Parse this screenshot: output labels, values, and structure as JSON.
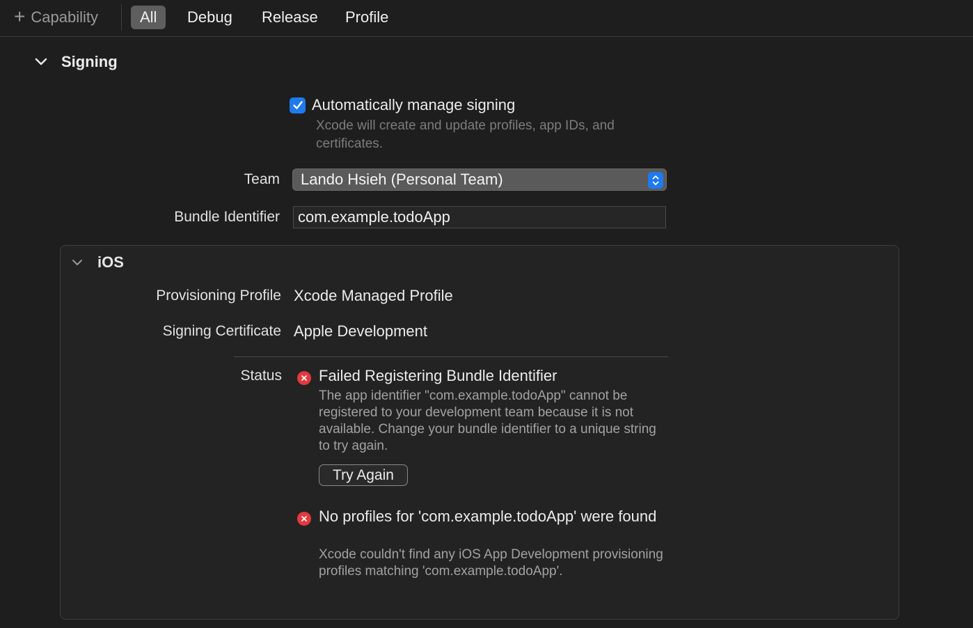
{
  "toolbar": {
    "capability_label": "Capability",
    "tabs": [
      {
        "label": "All",
        "active": true
      },
      {
        "label": "Debug",
        "active": false
      },
      {
        "label": "Release",
        "active": false
      },
      {
        "label": "Profile",
        "active": false
      }
    ]
  },
  "signing": {
    "title": "Signing",
    "auto_manage": {
      "label": "Automatically manage signing",
      "checked": true,
      "description": "Xcode will create and update profiles, app IDs, and certificates."
    },
    "team": {
      "label": "Team",
      "value": "Lando Hsieh (Personal Team)"
    },
    "bundle_identifier": {
      "label": "Bundle Identifier",
      "value": "com.example.todoApp"
    }
  },
  "ios": {
    "title": "iOS",
    "provisioning_profile": {
      "label": "Provisioning Profile",
      "value": "Xcode Managed Profile"
    },
    "signing_certificate": {
      "label": "Signing Certificate",
      "value": "Apple Development"
    },
    "status": {
      "label": "Status",
      "errors": [
        {
          "title": "Failed Registering Bundle Identifier",
          "description": "The app identifier \"com.example.todoApp\" cannot be registered to your development team because it is not available. Change your bundle identifier to a unique string to try again.",
          "button": "Try Again"
        },
        {
          "title": "No profiles for 'com.example.todoApp' were found",
          "description": "Xcode couldn't find any iOS App Development provisioning profiles matching 'com.example.todoApp'."
        }
      ]
    }
  },
  "colors": {
    "accent": "#1f7af0",
    "error": "#e5393e",
    "background": "#1e1e1e"
  }
}
